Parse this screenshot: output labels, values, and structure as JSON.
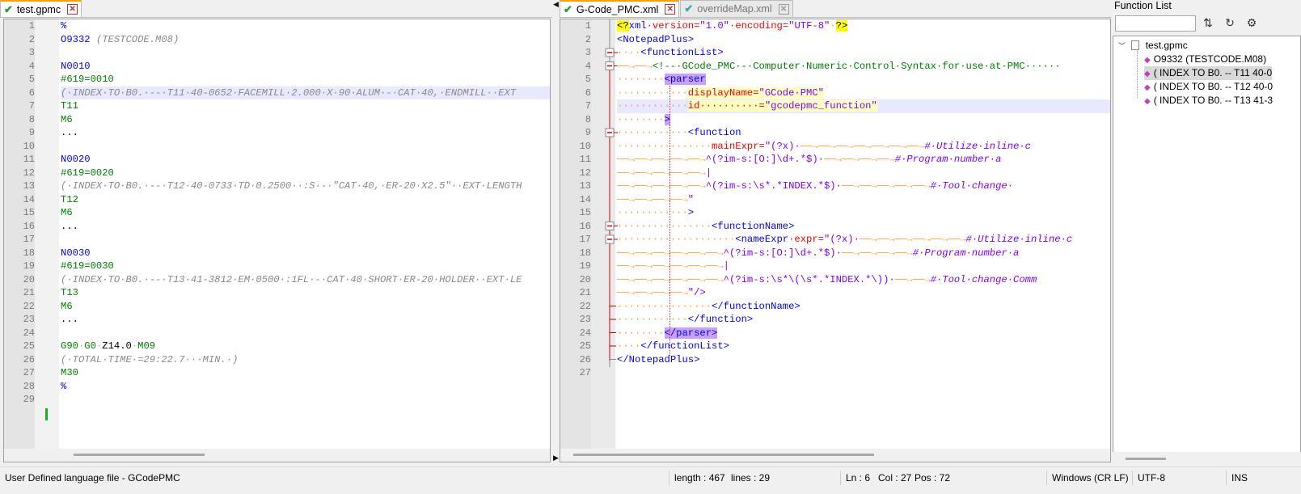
{
  "left_tabs": [
    {
      "label": "test.gpmc",
      "active": true
    }
  ],
  "right_tabs": [
    {
      "label": "G-Code_PMC.xml",
      "active": true
    },
    {
      "label": "overrideMap.xml",
      "active": false
    }
  ],
  "left_lines": [
    [
      [
        "%",
        "#0000ff",
        false
      ]
    ],
    [
      [
        "O9332",
        "#0000ff",
        false
      ],
      [
        " ",
        "#b0b0b0",
        false
      ],
      [
        "(TESTCODE.M08)",
        "#8a8a8a",
        true
      ]
    ],
    [],
    [
      [
        "N0010",
        "#0000ff",
        false
      ]
    ],
    [
      [
        "#619=0010",
        "#008000",
        false
      ]
    ],
    [
      [
        "(·INDEX·TO·B0.·--·T11·40-0652·FACEMILL·2.000·X·90·ALUM·-·CAT·40,·ENDMILL··EXT",
        "#8a8a8a",
        true
      ]
    ],
    [
      [
        "T11",
        "#008000",
        false
      ]
    ],
    [
      [
        "M6",
        "#008000",
        false
      ]
    ],
    [
      [
        "...",
        "#000000",
        false
      ]
    ],
    [],
    [
      [
        "N0020",
        "#0000ff",
        false
      ]
    ],
    [
      [
        "#619=0020",
        "#008000",
        false
      ]
    ],
    [
      [
        "(·INDEX·TO·B0.·--·T12·40-0733·TD·0.2500··:S·-·\"CAT·40,·ER-20·X2.5\"··EXT·LENGTH",
        "#8a8a8a",
        true
      ]
    ],
    [
      [
        "T12",
        "#008000",
        false
      ]
    ],
    [
      [
        "M6",
        "#008000",
        false
      ]
    ],
    [
      [
        "...",
        "#000000",
        false
      ]
    ],
    [],
    [
      [
        "N0030",
        "#0000ff",
        false
      ]
    ],
    [
      [
        "#619=0030",
        "#008000",
        false
      ]
    ],
    [
      [
        "(·INDEX·TO·B0.·--·T13·41-3812·EM·0500·:1FL·-·CAT·40·SHORT·ER-20·HOLDER··EXT·LE",
        "#8a8a8a",
        true
      ]
    ],
    [
      [
        "T13",
        "#008000",
        false
      ]
    ],
    [
      [
        "M6",
        "#008000",
        false
      ]
    ],
    [
      [
        "...",
        "#000000",
        false
      ]
    ],
    [],
    [
      [
        "G90",
        "#008000",
        false
      ],
      [
        "·",
        "#b0b0b0",
        false
      ],
      [
        "G0",
        "#008000",
        false
      ],
      [
        "·",
        "#b0b0b0",
        false
      ],
      [
        "Z14.0",
        "#000000",
        false
      ],
      [
        "·",
        "#b0b0b0",
        false
      ],
      [
        "M09",
        "#008000",
        false
      ]
    ],
    [
      [
        "(·TOTAL·TIME·=29:22.7···MIN.·)",
        "#8a8a8a",
        true
      ]
    ],
    [
      [
        "M30",
        "#008000",
        false
      ]
    ],
    [
      [
        "%",
        "#0000ff",
        false
      ]
    ],
    []
  ],
  "right_lines": [
    [
      [
        "<?",
        "#000000",
        false,
        "#ffff00"
      ],
      [
        "xml",
        "#0000ff",
        false
      ],
      [
        "·version=",
        "#ff0000",
        false
      ],
      [
        "\"1.0\"",
        "#8000ff",
        false
      ],
      [
        "·encoding=",
        "#ff0000",
        false
      ],
      [
        "\"UTF-8\"",
        "#8000ff",
        false
      ],
      [
        "·",
        "#ff9933",
        false
      ],
      [
        "?>",
        "#000000",
        false,
        "#ffff00"
      ]
    ],
    [
      [
        "<NotepadPlus>",
        "#0000ff",
        false
      ]
    ],
    [
      [
        "····",
        "#ff9933",
        false
      ],
      [
        "<functionList>",
        "#0000ff",
        false
      ]
    ],
    [
      [
        "──→──→",
        "#ff9933",
        false
      ],
      [
        "<!--·GCode_PMC·-·Computer·Numeric·Control·Syntax·for·use·at·PMC······",
        "#008000",
        false
      ]
    ],
    [
      [
        "········",
        "#ff9933",
        false
      ],
      [
        "<parser",
        "#0000ff",
        false,
        "#c8a0ff"
      ]
    ],
    [
      [
        "············",
        "#ff9933",
        false
      ],
      [
        "displayName=",
        "#ff0000",
        false,
        "#ffffc0"
      ],
      [
        "\"GCode·PMC\"",
        "#8000ff",
        false,
        "#ffffc0"
      ]
    ],
    [
      [
        "············",
        "#ff9933",
        false
      ],
      [
        "id··········=",
        "#ff0000",
        false,
        "#ffffc0"
      ],
      [
        "\"gcodepmc_function\"",
        "#8000ff",
        false,
        "#ffffc0"
      ]
    ],
    [
      [
        "········",
        "#ff9933",
        false
      ],
      [
        ">",
        "#0000ff",
        false,
        "#c8a0ff"
      ]
    ],
    [
      [
        "············",
        "#ff9933",
        false
      ],
      [
        "<function",
        "#0000ff",
        false
      ]
    ],
    [
      [
        "················",
        "#ff9933",
        false
      ],
      [
        "mainExpr=",
        "#ff0000",
        false
      ],
      [
        "\"(?x)·",
        "#8000ff",
        false
      ],
      [
        "──→──→──→──→──→──→──→",
        "#ff9933",
        false
      ],
      [
        "#·Utilize·inline·c",
        "#8000ff",
        true
      ]
    ],
    [
      [
        "──→──→──→──→──→",
        "#ff9933",
        false
      ],
      [
        "^(?im-s:[O:]\\d+.*$)·",
        "#8000ff",
        false
      ],
      [
        "──→──→──→──→",
        "#ff9933",
        false
      ],
      [
        "#·Program·number·a",
        "#8000ff",
        true
      ]
    ],
    [
      [
        "──→──→──→──→──→",
        "#ff9933",
        false
      ],
      [
        "|",
        "#8000ff",
        false
      ]
    ],
    [
      [
        "──→──→──→──→──→",
        "#ff9933",
        false
      ],
      [
        "^(?im-s:\\s*.*INDEX.*$)·",
        "#8000ff",
        false
      ],
      [
        "──→──→──→──→──→",
        "#ff9933",
        false
      ],
      [
        "#·Tool·change·",
        "#8000ff",
        true
      ]
    ],
    [
      [
        "──→──→──→──→",
        "#ff9933",
        false
      ],
      [
        "\"",
        "#8000ff",
        false
      ]
    ],
    [
      [
        "············",
        "#ff9933",
        false
      ],
      [
        ">",
        "#0000ff",
        false
      ]
    ],
    [
      [
        "················",
        "#ff9933",
        false
      ],
      [
        "<functionName>",
        "#0000ff",
        false
      ]
    ],
    [
      [
        "····················",
        "#ff9933",
        false
      ],
      [
        "<nameExpr",
        "#0000ff",
        false
      ],
      [
        "·expr=",
        "#ff0000",
        false
      ],
      [
        "\"(?x)·",
        "#8000ff",
        false
      ],
      [
        "──→──→──→──→──→──→",
        "#ff9933",
        false
      ],
      [
        "#·Utilize·inline·c",
        "#8000ff",
        true
      ]
    ],
    [
      [
        "──→──→──→──→──→──→",
        "#ff9933",
        false
      ],
      [
        "^(?im-s:[O:]\\d+.*$)·",
        "#8000ff",
        false
      ],
      [
        "──→──→──→──→",
        "#ff9933",
        false
      ],
      [
        "#·Program·number·a",
        "#8000ff",
        true
      ]
    ],
    [
      [
        "──→──→──→──→──→──→",
        "#ff9933",
        false
      ],
      [
        "|",
        "#8000ff",
        false
      ]
    ],
    [
      [
        "──→──→──→──→──→──→",
        "#ff9933",
        false
      ],
      [
        "^(?im-s:\\s*\\(\\s*.*INDEX.*\\))·",
        "#8000ff",
        false
      ],
      [
        "──→──→",
        "#ff9933",
        false
      ],
      [
        "#·Tool·change·Comm",
        "#8000ff",
        true
      ]
    ],
    [
      [
        "──→──→──→──→",
        "#ff9933",
        false
      ],
      [
        "\"/>",
        "#8000ff",
        false
      ]
    ],
    [
      [
        "················",
        "#ff9933",
        false
      ],
      [
        "</functionName>",
        "#0000ff",
        false
      ]
    ],
    [
      [
        "············",
        "#ff9933",
        false
      ],
      [
        "</function>",
        "#0000ff",
        false
      ]
    ],
    [
      [
        "········",
        "#ff9933",
        false
      ],
      [
        "</parser>",
        "#0000ff",
        false,
        "#c8a0ff"
      ]
    ],
    [
      [
        "····",
        "#ff9933",
        false
      ],
      [
        "</functionList>",
        "#0000ff",
        false
      ]
    ],
    [
      [
        "</NotepadPlus>",
        "#0000ff",
        false
      ]
    ],
    []
  ],
  "function_list": {
    "title": "Function List",
    "root": "test.gpmc",
    "items": [
      "O9332 (TESTCODE.M08)",
      "( INDEX TO B0. -- T11 40-0",
      "( INDEX TO B0. -- T12 40-0",
      "( INDEX TO B0. -- T13 41-3"
    ]
  },
  "status": {
    "lang": "User Defined language file - GCodePMC",
    "length": "length : 467",
    "lines": "lines : 29",
    "ln": "Ln : 6",
    "col": "Col : 27",
    "pos": "Pos : 72",
    "eol": "Windows (CR LF)",
    "enc": "UTF-8",
    "mode": "INS"
  },
  "colors": {
    "tab_accent": "#f9a000",
    "fold_marker": "#cc0000",
    "current_line": "#e8e8ff"
  }
}
